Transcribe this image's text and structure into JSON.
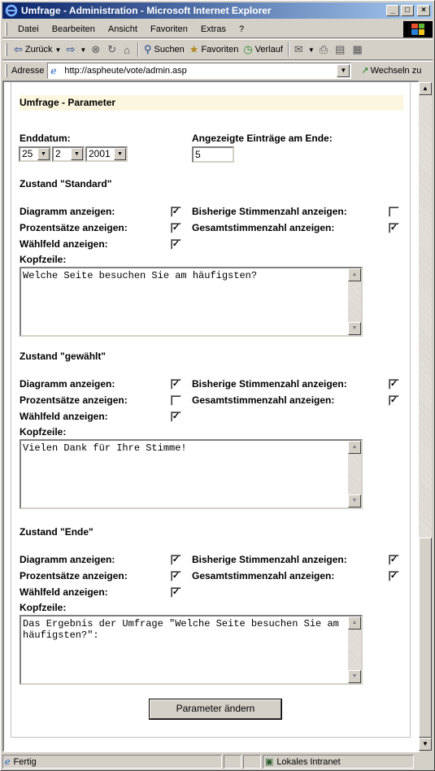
{
  "window": {
    "title": "Umfrage - Administration - Microsoft Internet Explorer",
    "minimize_glyph": "_",
    "maximize_glyph": "□",
    "close_glyph": "×"
  },
  "menu": [
    "Datei",
    "Bearbeiten",
    "Ansicht",
    "Favoriten",
    "Extras",
    "?"
  ],
  "toolbar": {
    "back": "Zurück",
    "search": "Suchen",
    "favorites": "Favoriten",
    "history": "Verlauf"
  },
  "address": {
    "label": "Adresse",
    "url": "http://aspheute/vote/admin.asp",
    "go": "Wechseln zu"
  },
  "form": {
    "section_title": "Umfrage - Parameter",
    "end_date_label": "Enddatum:",
    "end_day": "25",
    "end_month": "2",
    "end_year": "2001",
    "entries_label": "Angezeigte Einträge am Ende:",
    "entries_value": "5",
    "labels": {
      "chart": "Diagramm anzeigen:",
      "percent": "Prozentsätze anzeigen:",
      "choice": "Wählfeld anzeigen:",
      "prev_votes": "Bisherige Stimmenzahl anzeigen:",
      "total_votes": "Gesamtstimmenzahl anzeigen:",
      "header": "Kopfzeile:"
    },
    "states": [
      {
        "title": "Zustand \"Standard\"",
        "chart": true,
        "percent": true,
        "choice": true,
        "prev_votes": false,
        "total_votes": true,
        "header_text": "Welche Seite besuchen Sie am häufigsten?"
      },
      {
        "title": "Zustand \"gewählt\"",
        "chart": true,
        "percent": false,
        "choice": true,
        "prev_votes": true,
        "total_votes": true,
        "header_text": "Vielen Dank für Ihre Stimme!"
      },
      {
        "title": "Zustand \"Ende\"",
        "chart": true,
        "percent": true,
        "choice": true,
        "prev_votes": true,
        "total_votes": true,
        "header_text": "Das Ergebnis der Umfrage \"Welche Seite besuchen Sie am häufigsten?\":"
      }
    ],
    "submit_label": "Parameter ändern"
  },
  "status": {
    "text": "Fertig",
    "zone": "Lokales Intranet"
  }
}
